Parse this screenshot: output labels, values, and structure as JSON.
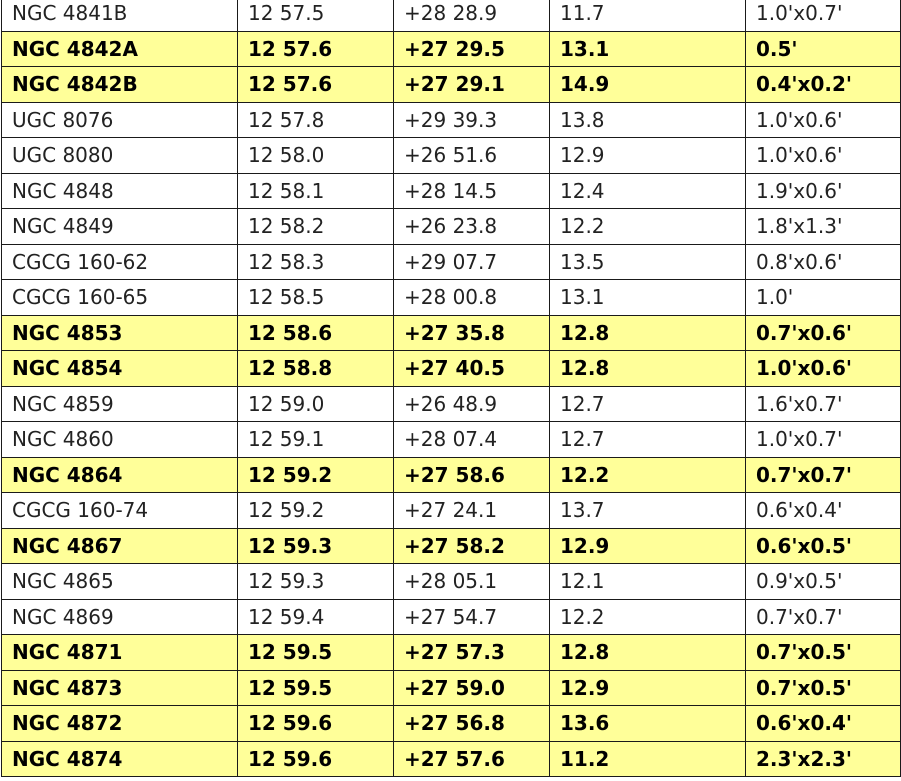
{
  "colors": {
    "highlight_row": "#ffff99",
    "normal_row": "#ffffff",
    "border": "#1a1a1a"
  },
  "rows": [
    {
      "name": "NGC 4841B",
      "ra": "12 57.5",
      "dec": "+28 28.9",
      "mag": "11.7",
      "size": "1.0'x0.7'",
      "highlight": false
    },
    {
      "name": "NGC 4842A",
      "ra": "12 57.6",
      "dec": "+27 29.5",
      "mag": "13.1",
      "size": "0.5'",
      "highlight": true
    },
    {
      "name": "NGC 4842B",
      "ra": "12 57.6",
      "dec": "+27 29.1",
      "mag": "14.9",
      "size": "0.4'x0.2'",
      "highlight": true
    },
    {
      "name": "UGC 8076",
      "ra": "12 57.8",
      "dec": "+29 39.3",
      "mag": "13.8",
      "size": "1.0'x0.6'",
      "highlight": false
    },
    {
      "name": "UGC 8080",
      "ra": "12 58.0",
      "dec": "+26 51.6",
      "mag": "12.9",
      "size": "1.0'x0.6'",
      "highlight": false
    },
    {
      "name": "NGC 4848",
      "ra": "12 58.1",
      "dec": "+28 14.5",
      "mag": "12.4",
      "size": "1.9'x0.6'",
      "highlight": false
    },
    {
      "name": "NGC 4849",
      "ra": "12 58.2",
      "dec": "+26 23.8",
      "mag": "12.2",
      "size": "1.8'x1.3'",
      "highlight": false
    },
    {
      "name": "CGCG 160-62",
      "ra": "12 58.3",
      "dec": "+29 07.7",
      "mag": "13.5",
      "size": "0.8'x0.6'",
      "highlight": false
    },
    {
      "name": "CGCG 160-65",
      "ra": "12 58.5",
      "dec": "+28 00.8",
      "mag": "13.1",
      "size": "1.0'",
      "highlight": false
    },
    {
      "name": "NGC 4853",
      "ra": "12 58.6",
      "dec": "+27 35.8",
      "mag": "12.8",
      "size": "0.7'x0.6'",
      "highlight": true
    },
    {
      "name": "NGC 4854",
      "ra": "12 58.8",
      "dec": "+27 40.5",
      "mag": "12.8",
      "size": "1.0'x0.6'",
      "highlight": true
    },
    {
      "name": "NGC 4859",
      "ra": "12 59.0",
      "dec": "+26 48.9",
      "mag": "12.7",
      "size": "1.6'x0.7'",
      "highlight": false
    },
    {
      "name": "NGC 4860",
      "ra": "12 59.1",
      "dec": "+28 07.4",
      "mag": "12.7",
      "size": "1.0'x0.7'",
      "highlight": false
    },
    {
      "name": "NGC 4864",
      "ra": "12 59.2",
      "dec": "+27 58.6",
      "mag": "12.2",
      "size": "0.7'x0.7'",
      "highlight": true
    },
    {
      "name": "CGCG 160-74",
      "ra": "12 59.2",
      "dec": "+27 24.1",
      "mag": "13.7",
      "size": "0.6'x0.4'",
      "highlight": false
    },
    {
      "name": "NGC 4867",
      "ra": "12 59.3",
      "dec": "+27 58.2",
      "mag": "12.9",
      "size": "0.6'x0.5'",
      "highlight": true
    },
    {
      "name": "NGC 4865",
      "ra": "12 59.3",
      "dec": "+28 05.1",
      "mag": "12.1",
      "size": "0.9'x0.5'",
      "highlight": false
    },
    {
      "name": "NGC 4869",
      "ra": "12 59.4",
      "dec": "+27 54.7",
      "mag": "12.2",
      "size": "0.7'x0.7'",
      "highlight": false
    },
    {
      "name": "NGC 4871",
      "ra": "12 59.5",
      "dec": "+27 57.3",
      "mag": "12.8",
      "size": "0.7'x0.5'",
      "highlight": true
    },
    {
      "name": "NGC 4873",
      "ra": "12 59.5",
      "dec": "+27 59.0",
      "mag": "12.9",
      "size": "0.7'x0.5'",
      "highlight": true
    },
    {
      "name": "NGC 4872",
      "ra": "12 59.6",
      "dec": "+27 56.8",
      "mag": "13.6",
      "size": "0.6'x0.4'",
      "highlight": true
    },
    {
      "name": "NGC 4874",
      "ra": "12 59.6",
      "dec": "+27 57.6",
      "mag": "11.2",
      "size": "2.3'x2.3'",
      "highlight": true
    }
  ]
}
